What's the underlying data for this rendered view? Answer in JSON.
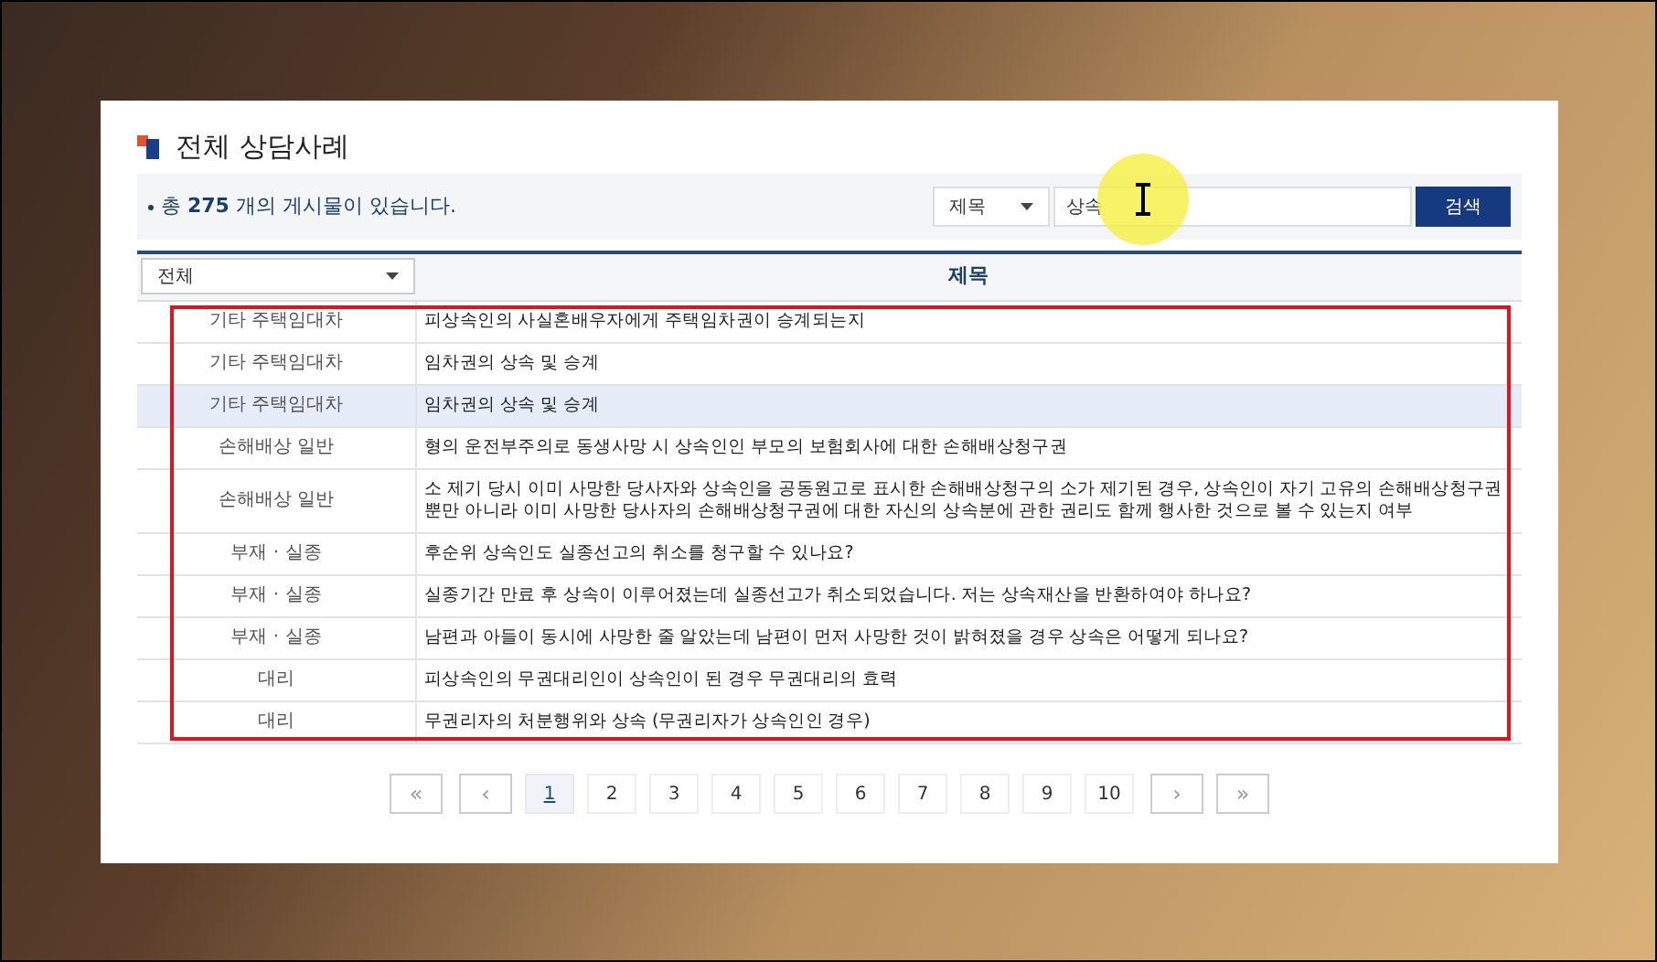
{
  "title": "전체 상담사례",
  "summary": {
    "prefix": "총",
    "count": "275",
    "suffix": "개의 게시물이 있습니다."
  },
  "search": {
    "field": "제목",
    "value": "상속",
    "button": "검색"
  },
  "table": {
    "category_filter": "전체",
    "column_title": "제목",
    "rows": [
      {
        "category": "기타 주택임대차",
        "title": "피상속인의 사실혼배우자에게 주택임차권이 승계되는지",
        "selected": false
      },
      {
        "category": "기타 주택임대차",
        "title": "임차권의 상속 및 승계",
        "selected": false
      },
      {
        "category": "기타 주택임대차",
        "title": "임차권의 상속 및 승계",
        "selected": true
      },
      {
        "category": "손해배상 일반",
        "title": "형의 운전부주의로 동생사망 시 상속인인 부모의 보험회사에 대한 손해배상청구권",
        "selected": false
      },
      {
        "category": "손해배상 일반",
        "title": "소 제기 당시 이미 사망한 당사자와 상속인을 공동원고로 표시한 손해배상청구의 소가 제기된 경우, 상속인이 자기 고유의 손해배상청구권뿐만 아니라 이미 사망한 당사자의 손해배상청구권에 대한 자신의 상속분에 관한 권리도 함께 행사한 것으로 볼 수 있는지 여부",
        "selected": false
      },
      {
        "category": "부재 · 실종",
        "title": "후순위 상속인도 실종선고의 취소를 청구할 수 있나요?",
        "selected": false
      },
      {
        "category": "부재 · 실종",
        "title": "실종기간 만료 후 상속이 이루어졌는데 실종선고가 취소되었습니다. 저는 상속재산을 반환하여야 하나요?",
        "selected": false
      },
      {
        "category": "부재 · 실종",
        "title": "남편과 아들이 동시에 사망한 줄 알았는데 남편이 먼저 사망한 것이 밝혀졌을 경우 상속은 어떻게 되나요?",
        "selected": false
      },
      {
        "category": "대리",
        "title": "피상속인의 무권대리인이 상속인이 된 경우 무권대리의 효력",
        "selected": false
      },
      {
        "category": "대리",
        "title": "무권리자의 처분행위와 상속 (무권리자가 상속인인 경우)",
        "selected": false
      }
    ],
    "annotation_outline": true
  },
  "pointer_highlight": true,
  "pagination": {
    "first": "«",
    "prev": "‹",
    "next": "›",
    "last": "»",
    "pages": [
      {
        "label": "1",
        "selected": true
      },
      {
        "label": "2",
        "selected": false
      },
      {
        "label": "3",
        "selected": false
      },
      {
        "label": "4",
        "selected": false
      },
      {
        "label": "5",
        "selected": false
      },
      {
        "label": "6",
        "selected": false
      },
      {
        "label": "7",
        "selected": false
      },
      {
        "label": "8",
        "selected": false
      },
      {
        "label": "9",
        "selected": false
      },
      {
        "label": "10",
        "selected": false
      }
    ]
  }
}
